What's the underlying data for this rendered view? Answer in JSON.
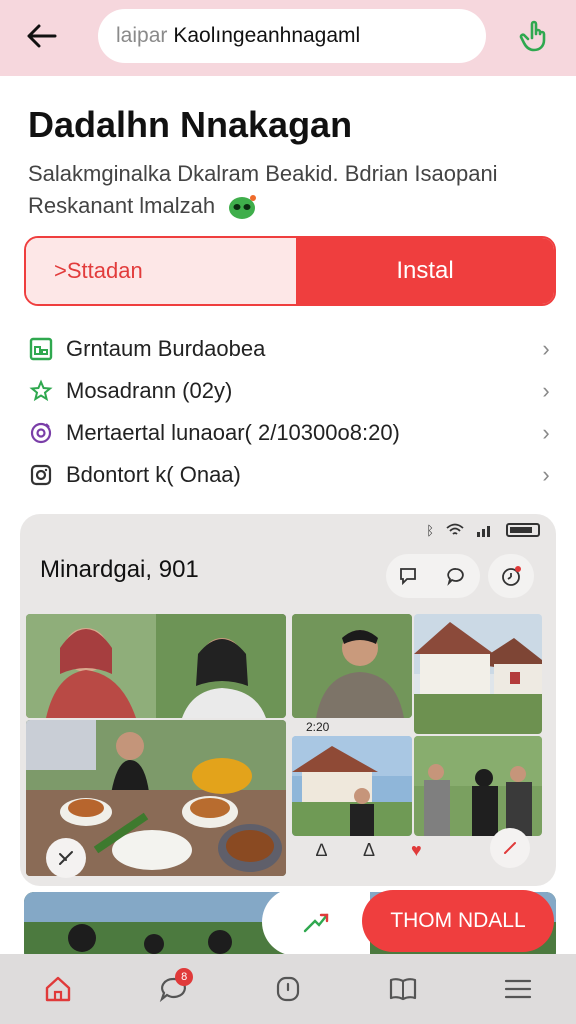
{
  "search": {
    "placeholder": "laipar",
    "value": "Kaolıngeanhnagaml"
  },
  "app": {
    "title": "Dadalhn Nnakagan",
    "subtitle_line1": "Salakmginalka Dkalram Beakid. Bdrian Isaopani",
    "subtitle_line2": "Reskanant lmalzah"
  },
  "actions": {
    "secondary_label": ">Sttadan",
    "primary_label": "Instal"
  },
  "info_rows": [
    {
      "label": "Grntaum Burdaobea",
      "icon": "grid-icon"
    },
    {
      "label": "Mosadrann (02y)",
      "icon": "star-icon"
    },
    {
      "label": "Mertaertal lunaoar( 2/10300o8:20)",
      "icon": "target-icon"
    },
    {
      "label": "Bdontort k( Onaa)",
      "icon": "camera-icon"
    }
  ],
  "preview": {
    "heading": "Minardgai, 901",
    "tag_time": "2:20",
    "bottom_icon_labels": [
      "∆",
      "Δ",
      "♥"
    ]
  },
  "cta": {
    "label": "THOM NDALL"
  },
  "nav": {
    "badge_count": "8",
    "items": [
      "home-icon",
      "chat-icon",
      "compass-icon",
      "book-icon",
      "menu-icon"
    ]
  },
  "colors": {
    "accent": "#ef3e3e",
    "topbar": "#f6d7dd",
    "success": "#2fa84f"
  }
}
